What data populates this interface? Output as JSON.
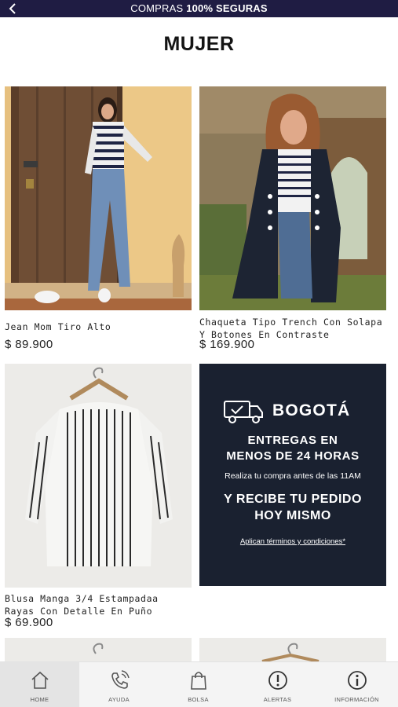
{
  "topbar": {
    "message_prefix": "COMPRAS ",
    "message_bold": "100% SEGURAS"
  },
  "page": {
    "title": "MUJER"
  },
  "products": [
    {
      "name": "Jean Mom Tiro Alto",
      "price": "$ 89.900"
    },
    {
      "name": "Chaqueta Tipo Trench Con Solapa Y Botones En Contraste",
      "price": "$ 169.900"
    },
    {
      "name": "Blusa Manga 3/4 Estampadaa Rayas Con Detalle En Puño",
      "price": "$ 69.900"
    }
  ],
  "promo": {
    "city": "BOGOTÁ",
    "line1": "ENTREGAS EN MENOS DE 24 HORAS",
    "line2": "Realiza tu compra antes de las 11AM",
    "line3": "Y RECIBE TU PEDIDO HOY MISMO",
    "terms": "Aplican términos y condiciones*",
    "bg_color": "#1a2130"
  },
  "bottom_nav": {
    "items": [
      {
        "label": "HOME",
        "icon": "home-icon",
        "active": true
      },
      {
        "label": "AYUDA",
        "icon": "phone-icon",
        "active": false
      },
      {
        "label": "BOLSA",
        "icon": "bag-icon",
        "active": false
      },
      {
        "label": "ALERTAS",
        "icon": "alert-icon",
        "active": false
      },
      {
        "label": "INFORMACIÓN",
        "icon": "info-icon",
        "active": false
      }
    ]
  },
  "colors": {
    "topbar": "#1f1c43",
    "text": "#1d1d1d"
  }
}
